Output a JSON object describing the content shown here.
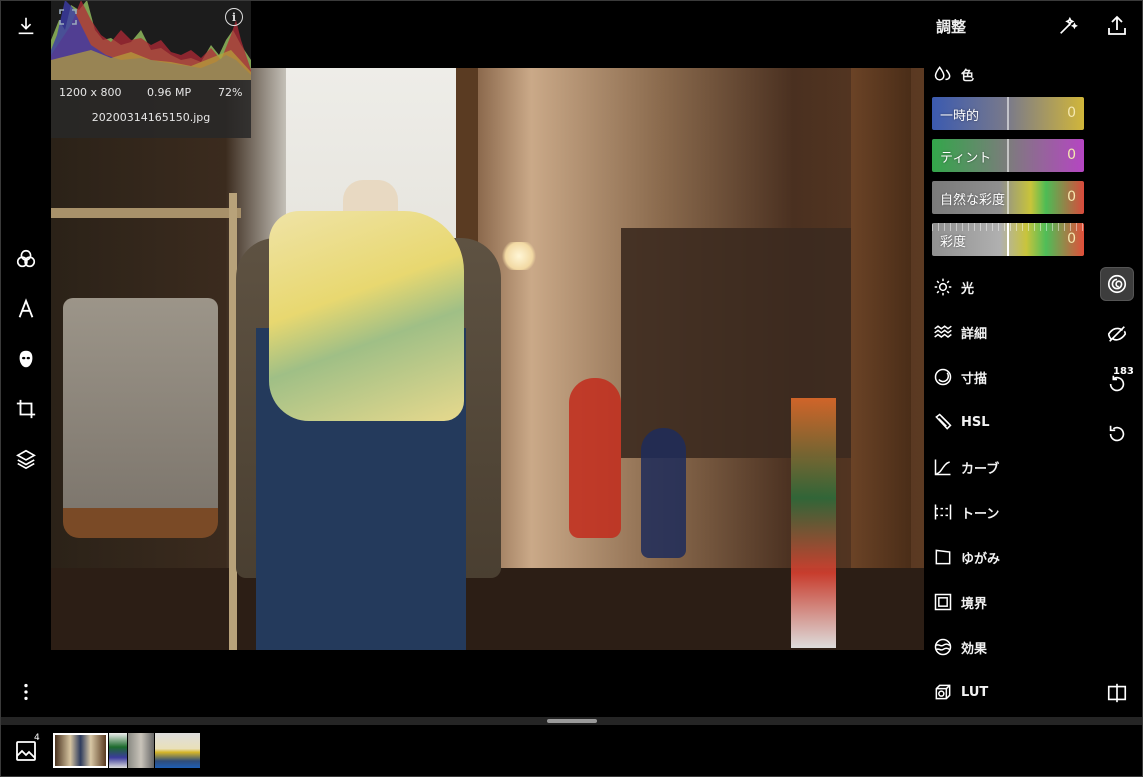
{
  "image_info": {
    "dimensions": "1200 x 800",
    "megapixels": "0.96 MP",
    "zoom": "72%",
    "filename": "20200314165150.jpg"
  },
  "panel": {
    "title": "調整",
    "color_section": "色",
    "sliders": [
      {
        "label": "一時的",
        "value": "0"
      },
      {
        "label": "ティント",
        "value": "0"
      },
      {
        "label": "自然な彩度",
        "value": "0"
      },
      {
        "label": "彩度",
        "value": "0"
      }
    ],
    "sections": [
      "光",
      "詳細",
      "寸描",
      "HSL",
      "カーブ",
      "トーン",
      "ゆがみ",
      "境界",
      "効果",
      "LUT"
    ]
  },
  "right_toolbar": {
    "history_count": "183"
  },
  "gallery": {
    "count": "4"
  },
  "colors": {
    "background": "#000000",
    "slider_value": "#f5e8b0",
    "active_tool_bg": "#3d3d3d"
  }
}
